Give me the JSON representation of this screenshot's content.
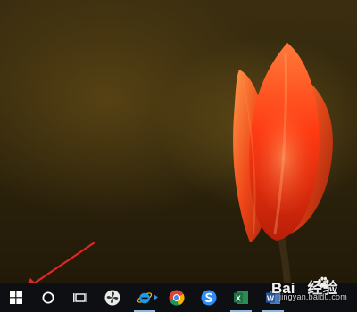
{
  "desktop": {
    "wallpaper": "red tulip on dark olive background"
  },
  "taskbar": {
    "items": [
      {
        "name": "start-button",
        "icon": "windows-logo-icon"
      },
      {
        "name": "search-button",
        "icon": "cortana-circle-icon"
      },
      {
        "name": "task-view-button",
        "icon": "task-view-icon"
      },
      {
        "name": "app-pinwheel",
        "icon": "pinwheel-icon"
      },
      {
        "name": "internet-explorer",
        "icon": "ie-icon"
      },
      {
        "name": "chrome",
        "icon": "chrome-icon"
      },
      {
        "name": "sogou",
        "icon": "sogou-s-icon"
      },
      {
        "name": "excel",
        "icon": "excel-icon",
        "letter": "X"
      },
      {
        "name": "word",
        "icon": "word-icon",
        "letter": "W"
      }
    ],
    "colors": {
      "background": "#0d0f12",
      "excel": "#1d7044",
      "word": "#2b579a",
      "active_underline": "#8fb6e0"
    }
  },
  "annotation": {
    "arrow_color": "#e0262a",
    "target": "start-button"
  },
  "watermark": {
    "logo_part1": "Bai",
    "logo_part2": "经验",
    "subtitle": "jingyan.baidu.com"
  }
}
